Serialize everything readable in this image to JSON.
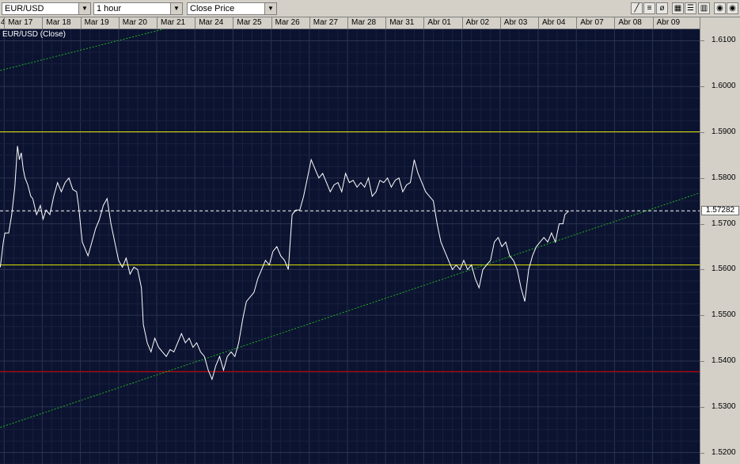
{
  "toolbar": {
    "symbol": "EUR/USD",
    "interval": "1 hour",
    "price_type": "Close Price",
    "tools": [
      "line-tool",
      "fib-tool",
      "no-draw-tool",
      "grid-tool",
      "list-tool",
      "settings-tool",
      "close-tool"
    ]
  },
  "colors": {
    "background": "#0b1330",
    "grid": "#2a3350",
    "price_line": "#ffffff",
    "support_resistance": "#e6e600",
    "red_line": "#e00000",
    "trend_line": "#22b022"
  },
  "chart_data": {
    "type": "line",
    "title": "EUR/USD (Close)",
    "ylim": [
      1.5175,
      1.6125
    ],
    "ytick_values": [
      1.52,
      1.53,
      1.54,
      1.55,
      1.56,
      1.57,
      1.58,
      1.59,
      1.6,
      1.61
    ],
    "ytick_labels": [
      "1.5200",
      "1.5300",
      "1.5400",
      "1.5500",
      "1.5600",
      "1.5700",
      "1.5800",
      "1.5900",
      "1.6000",
      "1.6100"
    ],
    "x_labels": [
      "4",
      "Mar 17",
      "Mar 18",
      "Mar 19",
      "Mar 20",
      "Mar 21",
      "Mar 24",
      "Mar 25",
      "Mar 26",
      "Mar 27",
      "Mar 28",
      "Mar 31",
      "Abr 01",
      "Abr 02",
      "Abr 03",
      "Abr 04",
      "Abr 07",
      "Abr 08",
      "Abr 09"
    ],
    "x_range": [
      0,
      18.5
    ],
    "current_price": 1.57282,
    "current_price_label": "1.57282",
    "horizontal_lines": [
      {
        "value": 1.5901,
        "kind": "resistance"
      },
      {
        "value": 1.561,
        "kind": "support"
      },
      {
        "value": 1.5377,
        "kind": "red"
      }
    ],
    "trend_lines": [
      {
        "x1": 0,
        "y1": 1.5255,
        "x2": 18.5,
        "y2": 1.5772
      },
      {
        "x1": 0,
        "y1": 1.6035,
        "x2": 4.4,
        "y2": 1.6128
      }
    ],
    "series": [
      {
        "name": "EUR/USD (Close)",
        "points": [
          [
            0.0,
            1.5605
          ],
          [
            0.08,
            1.566
          ],
          [
            0.12,
            1.568
          ],
          [
            0.22,
            1.568
          ],
          [
            0.3,
            1.572
          ],
          [
            0.38,
            1.578
          ],
          [
            0.45,
            1.587
          ],
          [
            0.5,
            1.584
          ],
          [
            0.55,
            1.5855
          ],
          [
            0.6,
            1.582
          ],
          [
            0.65,
            1.58
          ],
          [
            0.72,
            1.5785
          ],
          [
            0.8,
            1.576
          ],
          [
            0.85,
            1.5755
          ],
          [
            0.95,
            1.572
          ],
          [
            1.05,
            1.574
          ],
          [
            1.12,
            1.571
          ],
          [
            1.2,
            1.573
          ],
          [
            1.3,
            1.572
          ],
          [
            1.4,
            1.576
          ],
          [
            1.5,
            1.579
          ],
          [
            1.6,
            1.577
          ],
          [
            1.7,
            1.579
          ],
          [
            1.8,
            1.58
          ],
          [
            1.9,
            1.5775
          ],
          [
            2.0,
            1.577
          ],
          [
            2.05,
            1.574
          ],
          [
            2.15,
            1.566
          ],
          [
            2.25,
            1.564
          ],
          [
            2.3,
            1.563
          ],
          [
            2.4,
            1.566
          ],
          [
            2.5,
            1.569
          ],
          [
            2.6,
            1.571
          ],
          [
            2.7,
            1.574
          ],
          [
            2.8,
            1.5755
          ],
          [
            2.9,
            1.57
          ],
          [
            3.0,
            1.566
          ],
          [
            3.1,
            1.562
          ],
          [
            3.2,
            1.5605
          ],
          [
            3.3,
            1.5625
          ],
          [
            3.4,
            1.559
          ],
          [
            3.5,
            1.5605
          ],
          [
            3.6,
            1.56
          ],
          [
            3.7,
            1.556
          ],
          [
            3.75,
            1.548
          ],
          [
            3.85,
            1.544
          ],
          [
            3.95,
            1.542
          ],
          [
            4.05,
            1.545
          ],
          [
            4.15,
            1.543
          ],
          [
            4.25,
            1.542
          ],
          [
            4.35,
            1.541
          ],
          [
            4.45,
            1.5425
          ],
          [
            4.55,
            1.542
          ],
          [
            4.65,
            1.544
          ],
          [
            4.75,
            1.546
          ],
          [
            4.85,
            1.544
          ],
          [
            4.95,
            1.545
          ],
          [
            5.05,
            1.543
          ],
          [
            5.15,
            1.544
          ],
          [
            5.25,
            1.542
          ],
          [
            5.35,
            1.541
          ],
          [
            5.45,
            1.538
          ],
          [
            5.55,
            1.536
          ],
          [
            5.65,
            1.539
          ],
          [
            5.75,
            1.541
          ],
          [
            5.85,
            1.538
          ],
          [
            5.95,
            1.541
          ],
          [
            6.05,
            1.542
          ],
          [
            6.15,
            1.541
          ],
          [
            6.25,
            1.544
          ],
          [
            6.35,
            1.549
          ],
          [
            6.45,
            1.553
          ],
          [
            6.55,
            1.554
          ],
          [
            6.65,
            1.555
          ],
          [
            6.75,
            1.558
          ],
          [
            6.85,
            1.56
          ],
          [
            6.95,
            1.562
          ],
          [
            7.05,
            1.561
          ],
          [
            7.15,
            1.564
          ],
          [
            7.25,
            1.565
          ],
          [
            7.35,
            1.563
          ],
          [
            7.45,
            1.562
          ],
          [
            7.55,
            1.56
          ],
          [
            7.65,
            1.572
          ],
          [
            7.75,
            1.573
          ],
          [
            7.85,
            1.573
          ],
          [
            7.95,
            1.576
          ],
          [
            8.05,
            1.58
          ],
          [
            8.15,
            1.584
          ],
          [
            8.25,
            1.582
          ],
          [
            8.35,
            1.58
          ],
          [
            8.45,
            1.581
          ],
          [
            8.55,
            1.579
          ],
          [
            8.65,
            1.577
          ],
          [
            8.75,
            1.5785
          ],
          [
            8.85,
            1.579
          ],
          [
            8.95,
            1.577
          ],
          [
            9.05,
            1.581
          ],
          [
            9.15,
            1.579
          ],
          [
            9.25,
            1.5795
          ],
          [
            9.35,
            1.578
          ],
          [
            9.45,
            1.579
          ],
          [
            9.55,
            1.578
          ],
          [
            9.65,
            1.58
          ],
          [
            9.75,
            1.576
          ],
          [
            9.85,
            1.577
          ],
          [
            9.95,
            1.5795
          ],
          [
            10.05,
            1.579
          ],
          [
            10.15,
            1.58
          ],
          [
            10.25,
            1.578
          ],
          [
            10.35,
            1.5795
          ],
          [
            10.45,
            1.58
          ],
          [
            10.55,
            1.577
          ],
          [
            10.65,
            1.5785
          ],
          [
            10.75,
            1.579
          ],
          [
            10.85,
            1.584
          ],
          [
            10.95,
            1.581
          ],
          [
            11.05,
            1.579
          ],
          [
            11.15,
            1.577
          ],
          [
            11.25,
            1.576
          ],
          [
            11.35,
            1.575
          ],
          [
            11.45,
            1.57
          ],
          [
            11.55,
            1.566
          ],
          [
            11.65,
            1.564
          ],
          [
            11.75,
            1.562
          ],
          [
            11.85,
            1.56
          ],
          [
            11.95,
            1.561
          ],
          [
            12.05,
            1.56
          ],
          [
            12.15,
            1.562
          ],
          [
            12.25,
            1.56
          ],
          [
            12.35,
            1.561
          ],
          [
            12.45,
            1.558
          ],
          [
            12.55,
            1.556
          ],
          [
            12.65,
            1.56
          ],
          [
            12.75,
            1.561
          ],
          [
            12.85,
            1.562
          ],
          [
            12.95,
            1.566
          ],
          [
            13.05,
            1.567
          ],
          [
            13.15,
            1.565
          ],
          [
            13.25,
            1.566
          ],
          [
            13.35,
            1.563
          ],
          [
            13.45,
            1.562
          ],
          [
            13.55,
            1.56
          ],
          [
            13.65,
            1.556
          ],
          [
            13.75,
            1.553
          ],
          [
            13.85,
            1.56
          ],
          [
            13.95,
            1.563
          ],
          [
            14.05,
            1.565
          ],
          [
            14.15,
            1.566
          ],
          [
            14.25,
            1.567
          ],
          [
            14.35,
            1.566
          ],
          [
            14.45,
            1.568
          ],
          [
            14.55,
            1.566
          ],
          [
            14.65,
            1.57
          ],
          [
            14.75,
            1.57
          ],
          [
            14.8,
            1.572
          ],
          [
            14.9,
            1.5728
          ]
        ]
      }
    ]
  }
}
